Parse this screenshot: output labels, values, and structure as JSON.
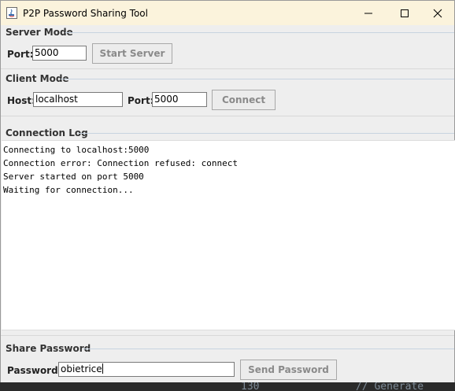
{
  "window": {
    "title": "P2P Password Sharing Tool"
  },
  "server_mode": {
    "title": "Server Mode",
    "port_label": "Port:",
    "port_value": "5000",
    "start_button": "Start Server"
  },
  "client_mode": {
    "title": "Client Mode",
    "host_label": "Host:",
    "host_value": "localhost",
    "port_label": "Port:",
    "port_value": "5000",
    "connect_button": "Connect"
  },
  "connection_log": {
    "title": "Connection Log",
    "lines": [
      "Connecting to localhost:5000",
      "Connection error: Connection refused: connect",
      "Server started on port 5000",
      "Waiting for connection..."
    ]
  },
  "share_password": {
    "title": "Share Password",
    "password_label": "Password:",
    "password_value": "obietrice",
    "send_button": "Send Password"
  },
  "background": {
    "left_text": "130",
    "right_text": "// Generate"
  },
  "colors": {
    "titlebar_bg": "#fbf3dc",
    "panel_bg": "#eeeeee",
    "disabled_text": "#8a8a8a"
  }
}
